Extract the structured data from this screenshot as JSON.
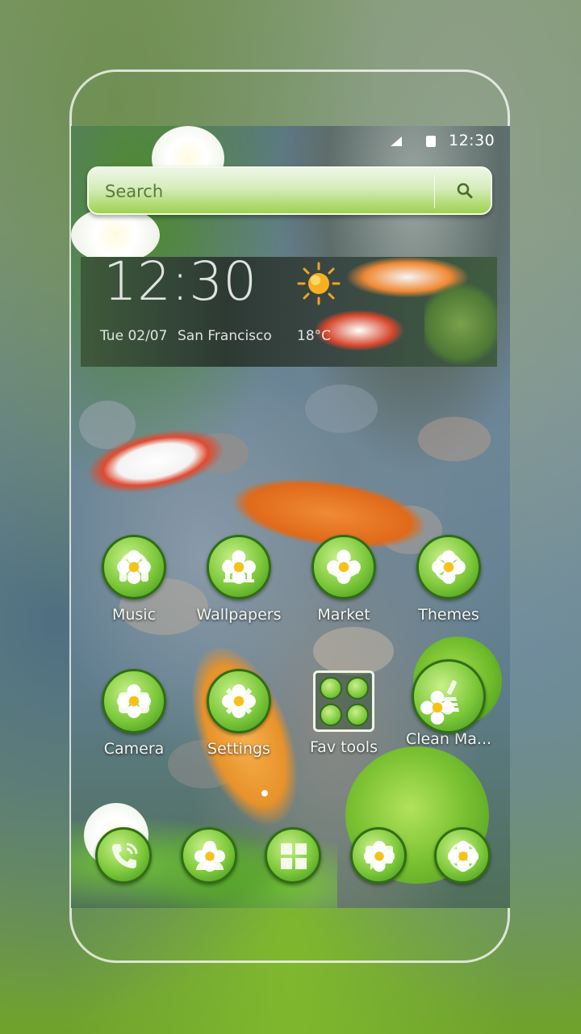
{
  "status_bar": {
    "time": "12:30"
  },
  "search": {
    "placeholder": "Search"
  },
  "weather_widget": {
    "time": "12:30",
    "date": "Tue 02/07",
    "city": "San Francisco",
    "temperature": "18°C"
  },
  "apps": [
    {
      "label": "Music",
      "icon": "headphones-icon"
    },
    {
      "label": "Wallpapers",
      "icon": "wallpapers-icon"
    },
    {
      "label": "Market",
      "icon": "market-bag-icon"
    },
    {
      "label": "Themes",
      "icon": "palette-icon"
    },
    {
      "label": "Camera",
      "icon": "camera-icon"
    },
    {
      "label": "Settings",
      "icon": "gear-icon"
    },
    {
      "label": "Fav tools",
      "icon": "folder-icon"
    },
    {
      "label": "Clean Ma...",
      "icon": "broom-icon"
    }
  ],
  "dock": [
    {
      "icon": "phone-icon"
    },
    {
      "icon": "contacts-icon"
    },
    {
      "icon": "app-drawer-icon"
    },
    {
      "icon": "messages-icon"
    },
    {
      "icon": "browser-globe-icon"
    }
  ],
  "colors": {
    "accent": "#7cc83a",
    "icon_border": "#2f6e12"
  }
}
